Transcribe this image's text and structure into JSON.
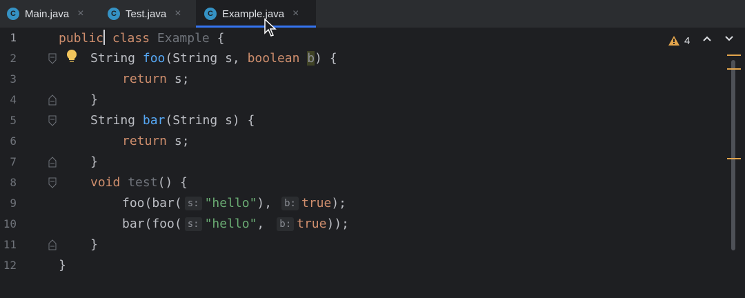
{
  "tabs": [
    {
      "icon": "C",
      "label": "Main.java",
      "close": "×"
    },
    {
      "icon": "C",
      "label": "Test.java",
      "close": "×"
    },
    {
      "icon": "C",
      "label": "Example.java",
      "close": "×"
    }
  ],
  "active_tab_index": 2,
  "inspection_widget": {
    "warning_count": "4"
  },
  "line_numbers": [
    "1",
    "2",
    "3",
    "4",
    "5",
    "6",
    "7",
    "8",
    "9",
    "10",
    "11",
    "12"
  ],
  "code": {
    "l1": {
      "kw1": "public",
      "kw2": " class ",
      "name": "Example",
      "rest": " {"
    },
    "l2": {
      "type": "String ",
      "method": "foo",
      "open": "(String s, ",
      "kw": "boolean",
      "sp": " ",
      "param": "b",
      "close": ") {"
    },
    "l3": {
      "kw": "return",
      "rest": " s;"
    },
    "l4": {
      "text": "}"
    },
    "l5": {
      "type": "String ",
      "method": "bar",
      "rest": "(String s) {"
    },
    "l6": {
      "kw": "return",
      "rest": " s;"
    },
    "l7": {
      "text": "}"
    },
    "l8": {
      "kw": "void",
      "sp": " ",
      "name": "test",
      "rest": "() {"
    },
    "l9": {
      "a": "foo(bar(",
      "hint1": "s:",
      "str": "\"hello\"",
      "mid": "),",
      "hint2": "b:",
      "kw": "true",
      "end": ");"
    },
    "l10": {
      "a": "bar(foo(",
      "hint1": "s:",
      "str": "\"hello\"",
      "mid": ",",
      "hint2": "b:",
      "kw": "true",
      "end": "));"
    },
    "l11": {
      "text": "}"
    },
    "l12": {
      "text": "}"
    }
  },
  "colors": {
    "keyword": "#cf8e6d",
    "method": "#56a8f5",
    "string": "#6aab73",
    "text": "#bcbec4",
    "warning": "#e3a54c",
    "tab_underline": "#3574f0",
    "java_icon": "#3592c4"
  }
}
